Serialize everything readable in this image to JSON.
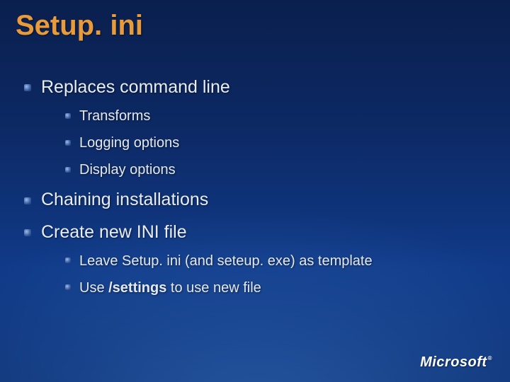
{
  "title": "Setup. ini",
  "bullets": {
    "b1": {
      "text": "Replaces command line",
      "sub": {
        "s1": "Transforms",
        "s2": "Logging options",
        "s3": "Display options"
      }
    },
    "b2": {
      "text": "Chaining installations"
    },
    "b3": {
      "text": "Create new INI file",
      "sub": {
        "s1": "Leave Setup. ini (and seteup. exe) as template",
        "s2_pre": "Use ",
        "s2_bold": "/settings",
        "s2_post": " to use new file"
      }
    }
  },
  "logo": "Microsoft"
}
